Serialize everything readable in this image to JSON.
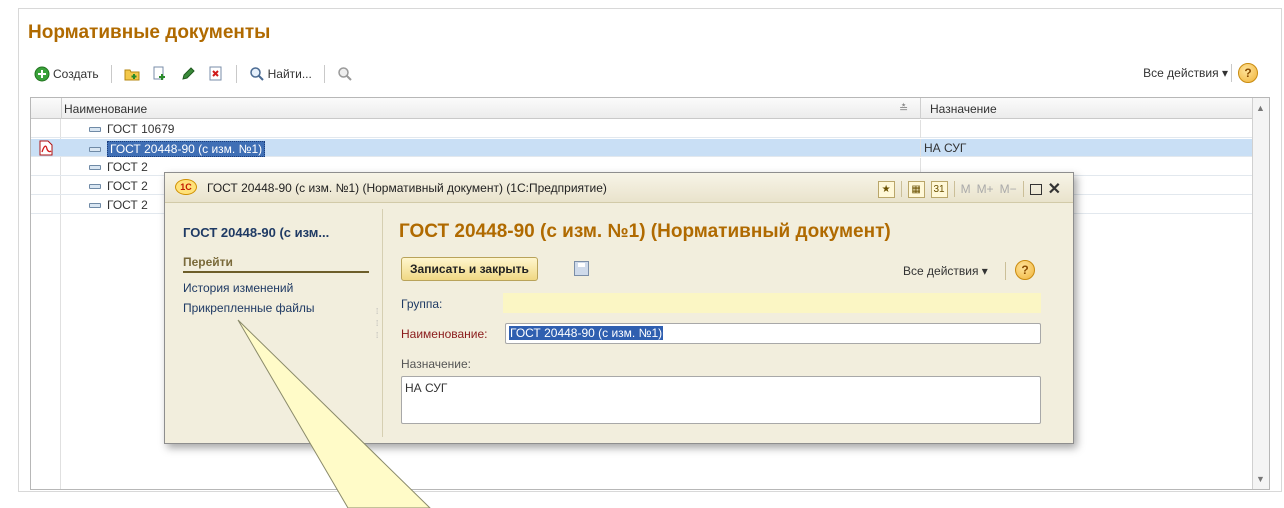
{
  "list": {
    "title": "Нормативные документы",
    "toolbar": {
      "create_label": "Создать",
      "find_label": "Найти...",
      "all_actions_label": "Все действия ▾",
      "help_label": "?"
    },
    "columns": {
      "name": "Наименование",
      "destination": "Назначение"
    },
    "rows": [
      {
        "name": "ГОСТ 10679",
        "destination": ""
      },
      {
        "name": "ГОСТ 20448-90 (с изм. №1)",
        "destination": "НА СУГ"
      },
      {
        "name": "ГОСТ 2",
        "destination": ""
      },
      {
        "name": "ГОСТ 2",
        "destination": ""
      },
      {
        "name": "ГОСТ 2",
        "destination": ""
      }
    ]
  },
  "dialog": {
    "window_title": "ГОСТ 20448-90 (с изм. №1) (Нормативный документ)  (1С:Предприятие)",
    "logo_text": "1С",
    "title_buttons": {
      "m": "M",
      "mplus": "M+",
      "mminus": "M−"
    },
    "side": {
      "title": "ГОСТ 20448-90 (с изм...",
      "section": "Перейти",
      "items": [
        "История изменений",
        "Прикрепленные файлы"
      ]
    },
    "heading": "ГОСТ 20448-90 (с изм. №1) (Нормативный документ)",
    "save_close_label": "Записать и закрыть",
    "all_actions_label": "Все действия ▾",
    "help_label": "?",
    "fields": {
      "group_label": "Группа:",
      "group_value": "",
      "name_label": "Наименование:",
      "name_value": "ГОСТ 20448-90 (с изм. №1)",
      "dest_label": "Назначение:",
      "dest_value": "НА СУГ"
    }
  },
  "colors": {
    "title_orange": "#b06a00",
    "selection_blue": "#c9dff5",
    "dialog_bg": "#f2eedd",
    "callout_fill": "#fffbc8"
  }
}
